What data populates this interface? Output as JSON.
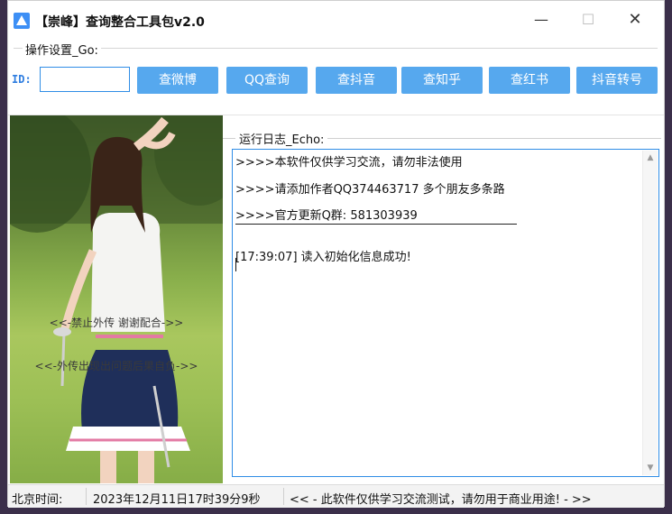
{
  "window": {
    "title": "【崇峰】查询整合工具包v2.0",
    "controls": {
      "minimize": "—",
      "maximize": "☐",
      "close": "✕"
    }
  },
  "settings": {
    "group_label": "操作设置_Go:",
    "id_label": "ID:",
    "id_value": "",
    "buttons": [
      "查微博",
      "QQ查询",
      "查抖音",
      "查知乎",
      "查红书",
      "抖音转号"
    ]
  },
  "warnings": [
    "<<-禁止外传 谢谢配合->>",
    "<<-外传出现出问题后果自负->>"
  ],
  "log": {
    "group_label": "运行日志_Echo:",
    "lines": [
      ">>>>本软件仅供学习交流，请勿非法使用",
      ">>>>请添加作者QQ374463717 多个朋友多条路",
      ">>>>官方更新Q群: 581303939",
      "[17:39:07]  读入初始化信息成功!"
    ]
  },
  "status": {
    "time_label": "北京时间:",
    "datetime": "2023年12月11日17时39分9秒",
    "notice": "<< - 此软件仅供学习交流测试，请勿用于商业用途!  - >>"
  },
  "colors": {
    "accent": "#56a8ee",
    "border_accent": "#2f8de6",
    "id_label": "#2e7de0"
  },
  "icons": [
    "app-icon",
    "scroll-up-icon",
    "scroll-down-icon"
  ]
}
